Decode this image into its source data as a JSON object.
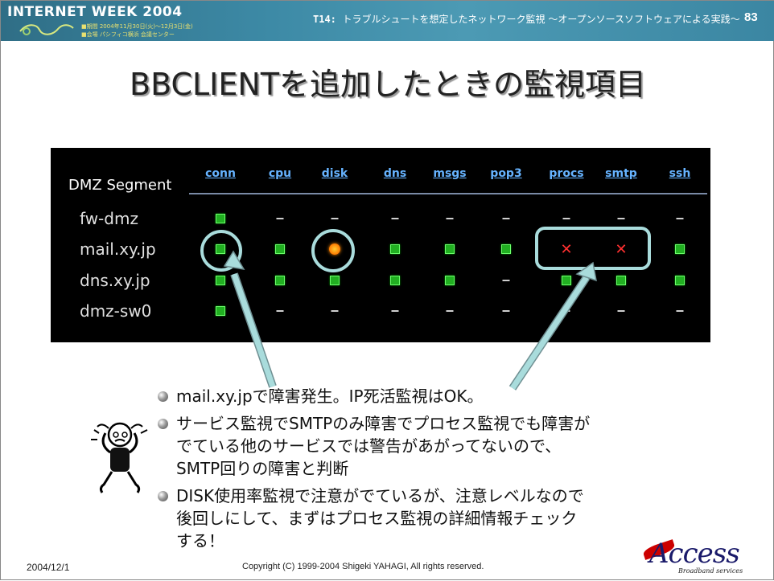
{
  "header": {
    "logo_title": "INTERNET WEEK 2004",
    "logo_sub1": "■期間 2004年11月30日(火)～12月3日(金)",
    "logo_sub2": "■会場 パシフィコ横浜 会議センター",
    "session_id": "T14:",
    "session_text": "トラブルシュートを想定したネットワーク監視 ～オープンソースソフトウェアによる実践～",
    "page_number": "83"
  },
  "title": "BBCLIENTを追加したときの監視項目",
  "monitor": {
    "segment": "DMZ Segment",
    "columns": [
      "conn",
      "cpu",
      "disk",
      "dns",
      "msgs",
      "pop3",
      "procs",
      "smtp",
      "ssh"
    ],
    "hosts": [
      {
        "name": "fw-dmz",
        "status": [
          "green",
          "dash",
          "dash",
          "dash",
          "dash",
          "dash",
          "dash",
          "dash",
          "dash"
        ]
      },
      {
        "name": "mail.xy.jp",
        "status": [
          "green",
          "green",
          "amber",
          "green",
          "green",
          "green",
          "red",
          "red",
          "green"
        ]
      },
      {
        "name": "dns.xy.jp",
        "status": [
          "green",
          "green",
          "green",
          "green",
          "green",
          "dash",
          "green",
          "green",
          "green"
        ]
      },
      {
        "name": "dmz-sw0",
        "status": [
          "green",
          "dash",
          "dash",
          "dash",
          "dash",
          "dash",
          "dash",
          "dash",
          "dash"
        ]
      }
    ],
    "status_colors": {
      "green": "#22b022",
      "amber": "#ff7a00",
      "red": "#ff3030"
    }
  },
  "bullets": [
    "mail.xy.jpで障害発生。IP死活監視はOK。",
    "サービス監視でSMTPのみ障害でプロセス監視でも障害がでている他のサービスでは警告があがってないので、SMTP回りの障害と判断",
    "DISK使用率監視で注意がでているが、注意レベルなので後回しにして、まずはプロセス監視の詳細情報チェックする！"
  ],
  "footer": {
    "date": "2004/12/1",
    "copyright": "Copyright (C) 1999-2004 Shigeki YAHAGI, All rights reserved.",
    "logo": "Access",
    "logo_sub": "Broadband services"
  },
  "colors": {
    "header_bg": "#3d8aa6",
    "highlight_ring": "#a9dcdc",
    "link_blue": "#66b3ff"
  }
}
